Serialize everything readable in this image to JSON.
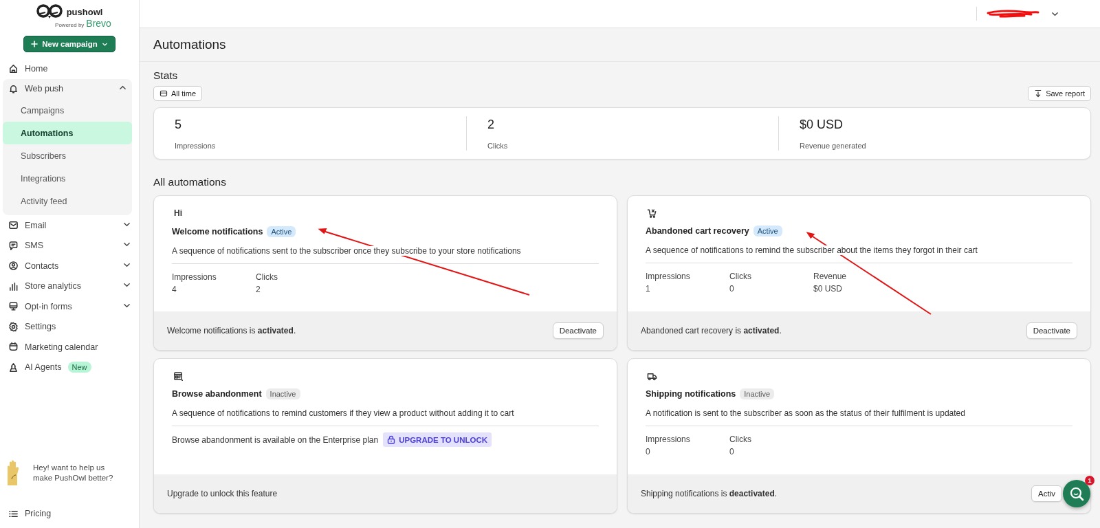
{
  "sidebar": {
    "logo": {
      "name": "pushowl",
      "tagline": "Powered by",
      "brand": "Brevo"
    },
    "new_campaign_button": "New campaign",
    "nav": [
      {
        "kind": "link",
        "label": "Home",
        "selected": false
      },
      {
        "kind": "group",
        "label": "Web push",
        "expanded": true,
        "children": [
          {
            "label": "Campaigns",
            "selected": false
          },
          {
            "label": "Automations",
            "selected": true
          },
          {
            "label": "Subscribers",
            "selected": false
          },
          {
            "label": "Integrations",
            "selected": false
          },
          {
            "label": "Activity feed",
            "selected": false
          }
        ]
      },
      {
        "kind": "group",
        "label": "Email",
        "expanded": false
      },
      {
        "kind": "group",
        "label": "SMS",
        "expanded": false
      },
      {
        "kind": "group",
        "label": "Contacts",
        "expanded": false
      },
      {
        "kind": "group",
        "label": "Store analytics",
        "expanded": false
      },
      {
        "kind": "group",
        "label": "Opt-in forms",
        "expanded": false
      },
      {
        "kind": "link",
        "label": "Settings",
        "selected": false
      },
      {
        "kind": "link",
        "label": "Marketing calendar",
        "selected": false
      },
      {
        "kind": "link",
        "label": "AI Agents",
        "selected": false,
        "badge": "New"
      }
    ],
    "feedback": "Hey! want to help us make PushOwl better?",
    "pricing": "Pricing"
  },
  "page_title": "Automations",
  "stats": {
    "title": "Stats",
    "period_button": "All time",
    "save_report_button": "Save report",
    "items": [
      {
        "value": "5",
        "label": "Impressions"
      },
      {
        "value": "2",
        "label": "Clicks"
      },
      {
        "value": "$0 USD",
        "label": "Revenue generated"
      }
    ]
  },
  "automations": {
    "title": "All automations",
    "cards": [
      {
        "icon_text": "Hi",
        "title": "Welcome notifications",
        "status": "Active",
        "active": true,
        "description": "A sequence of notifications sent to the subscriber once they subscribe to your store notifications",
        "metrics": [
          {
            "label": "Impressions",
            "value": "4"
          },
          {
            "label": "Clicks",
            "value": "2"
          }
        ],
        "footer_text": "Welcome notifications is **activated**.",
        "action_button": "Deactivate"
      },
      {
        "title": "Abandoned cart recovery",
        "status": "Active",
        "active": true,
        "description": "A sequence of notifications to remind the subscriber about the items they forgot in their cart",
        "metrics": [
          {
            "label": "Impressions",
            "value": "1"
          },
          {
            "label": "Clicks",
            "value": "0"
          },
          {
            "label": "Revenue",
            "value": "$0 USD"
          }
        ],
        "footer_text": "Abandoned cart recovery is **activated**.",
        "action_button": "Deactivate"
      },
      {
        "title": "Browse abandonment",
        "status": "Inactive",
        "active": false,
        "description": "A sequence of notifications to remind customers if they view a product without adding it to cart",
        "upgrade_note": "Browse abandonment is available on the Enterprise plan",
        "upgrade_button": "UPGRADE TO UNLOCK",
        "footer_text": "Upgrade to unlock this feature"
      },
      {
        "title": "Shipping notifications",
        "status": "Inactive",
        "active": false,
        "description": "A notification is sent to the subscriber as soon as the status of their fulfilment is updated",
        "metrics": [
          {
            "label": "Impressions",
            "value": "0"
          },
          {
            "label": "Clicks",
            "value": "0"
          }
        ],
        "footer_text": "Shipping notifications is **deactivated**.",
        "action_button": "Activ"
      }
    ]
  },
  "chat_widget": {
    "unread": "1"
  }
}
